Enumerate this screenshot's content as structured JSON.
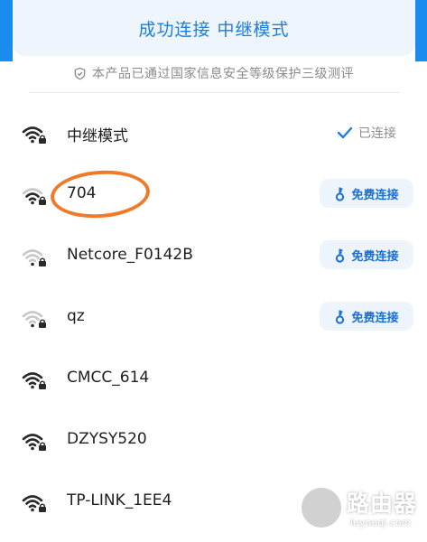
{
  "header": {
    "title": "成功连接 中继模式"
  },
  "security": {
    "text": "本产品已通过国家信息安全等级保护三级测评"
  },
  "networks": [
    {
      "ssid": "中继模式",
      "status": "已连接",
      "signal": 4
    },
    {
      "ssid": "704",
      "action": "免费连接",
      "signal": 3
    },
    {
      "ssid": "Netcore_F0142B",
      "action": "免费连接",
      "signal": 1
    },
    {
      "ssid": "qz",
      "action": "免费连接",
      "signal": 1
    },
    {
      "ssid": "CMCC_614",
      "signal": 4
    },
    {
      "ssid": "DZYSY520",
      "signal": 4
    },
    {
      "ssid": "TP-LINK_1EE4",
      "signal": 4
    }
  ],
  "watermark": {
    "title": "路由器",
    "url": "luyouqi.com"
  },
  "colors": {
    "accent": "#1a8cf0",
    "title_blue": "#1a7fe0",
    "annotation_orange": "#ef7b28"
  },
  "icons": {
    "signal": "wifi-lock-icon",
    "status": "check-icon",
    "action": "key-icon",
    "security": "shield-icon"
  }
}
